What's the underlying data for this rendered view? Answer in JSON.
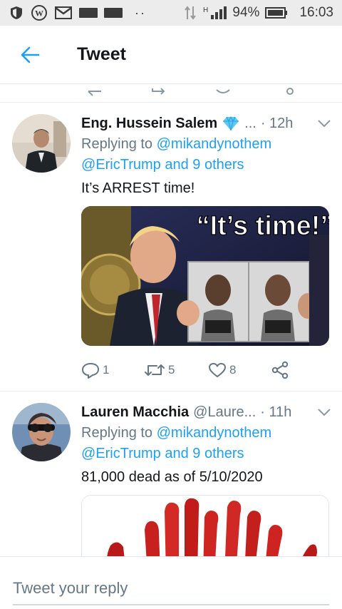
{
  "status_bar": {
    "icons": [
      "shield-icon",
      "wordpress-icon",
      "gmail-icon",
      "notification-bar-icon",
      "notification-bar-icon",
      "more-dots-icon"
    ],
    "battery": "94%",
    "time": "16:03",
    "network_label": "H"
  },
  "header": {
    "title": "Tweet",
    "back_icon": "arrow-left-icon",
    "accent": "#1da1f2"
  },
  "tweets": [
    {
      "name": "Eng. Hussein Salem",
      "badge_icon": "gem-emoji-icon",
      "handle": "...",
      "time": "· 12h",
      "replying_to_prefix": "Replying to",
      "replying_to_user": "@mikandynothem",
      "replying_to_more": "@EricTrump and 9 others",
      "text": "It’s ARREST time!",
      "media_caption": "“It’s time!”",
      "actions": {
        "replies": "1",
        "retweets": "5",
        "likes": "8"
      }
    },
    {
      "name": "Lauren Macchia",
      "handle": "@Laure...",
      "time": "· 11h",
      "replying_to_prefix": "Replying to",
      "replying_to_user": "@mikandynothem",
      "replying_to_more": "@EricTrump and 9 others",
      "text": "81,000 dead as of 5/10/2020"
    }
  ],
  "reply_bar": {
    "placeholder": "Tweet your reply"
  }
}
